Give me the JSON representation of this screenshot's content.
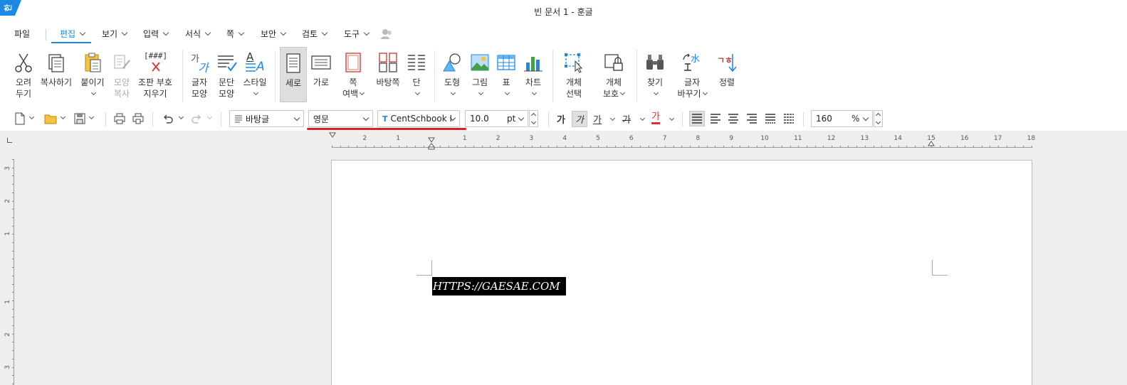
{
  "window": {
    "title": "빈 문서 1 - 훈글",
    "logo_text": "한"
  },
  "menu": {
    "file": "파일",
    "tabs": [
      {
        "label": "편집",
        "active": true
      },
      {
        "label": "보기"
      },
      {
        "label": "입력"
      },
      {
        "label": "서식"
      },
      {
        "label": "쪽"
      },
      {
        "label": "보안"
      },
      {
        "label": "검토"
      },
      {
        "label": "도구"
      }
    ]
  },
  "ribbon": {
    "cut": [
      "오려",
      "두기"
    ],
    "copy": "복사하기",
    "paste": "붙이기",
    "format_copy": [
      "모양",
      "복사"
    ],
    "clear_format": [
      "조판 부호",
      "지우기"
    ],
    "char_shape": [
      "글자",
      "모양"
    ],
    "para_shape": [
      "문단",
      "모양"
    ],
    "style": "스타일",
    "portrait": "세로",
    "landscape": "가로",
    "page_margin": [
      "쪽",
      "여백"
    ],
    "background": "바탕쪽",
    "columns": "단",
    "shapes": "도형",
    "picture": "그림",
    "table": "표",
    "chart": "차트",
    "select_object": [
      "개체",
      "선택"
    ],
    "protect_object": [
      "개체",
      "보호"
    ],
    "find": "찾기",
    "replace": [
      "글자",
      "바꾸기"
    ],
    "sort": "정렬",
    "clear_format_icon_text": "[###]",
    "char_icon_text": "가",
    "style_icon_text": "A",
    "replace_icon_text": "水",
    "sort_icon_text": "ㄱㅎ"
  },
  "toolbar": {
    "style_combo": "바탕글",
    "lang_combo": "영문",
    "font_combo": "CentSchbook I",
    "size_value": "10.0",
    "size_unit": "pt",
    "format_letter": "가",
    "zoom_value": "160",
    "zoom_unit": "%"
  },
  "ruler": {
    "h_numbers": [
      "2",
      "1",
      "1",
      "2",
      "3",
      "4",
      "5",
      "6",
      "7",
      "8",
      "9",
      "10",
      "11",
      "12",
      "13",
      "14",
      "15",
      "16",
      "17",
      "18"
    ],
    "v_numbers": [
      "3",
      "2",
      "1",
      "1",
      "2",
      "3"
    ]
  },
  "document": {
    "text": "HTTPS://GAESAE.COM"
  },
  "colors": {
    "accent": "#1e88e5",
    "highlight_underline": "#e02020",
    "selection_bg": "#000000"
  }
}
